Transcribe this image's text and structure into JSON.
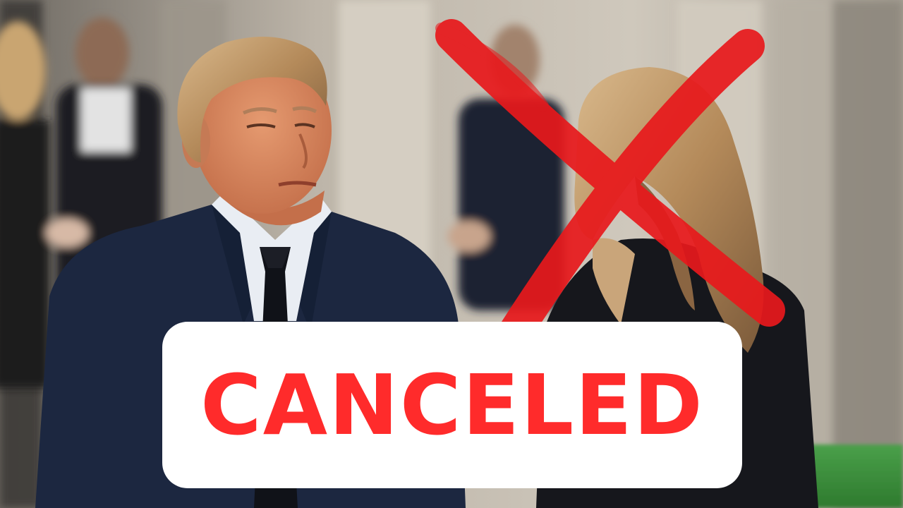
{
  "overlay": {
    "headline": "CANCELED",
    "headline_color": "#ff2b2b",
    "banner_color": "#ffffff",
    "mark": "red-x-strike",
    "mark_color": "#e8191c"
  },
  "photo": {
    "palette": {
      "background_stone": "#c9c3b8",
      "suit_navy": "#1c2740",
      "shirt_white": "#e9edf3",
      "tie_black": "#101218",
      "hair_blonde": "#b48a5a",
      "jacket_black": "#16171c",
      "grass_green": "#3a8a3a"
    }
  }
}
